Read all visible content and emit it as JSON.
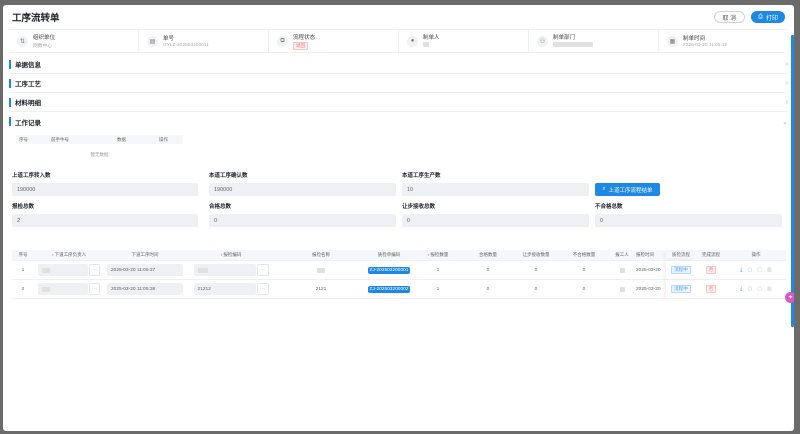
{
  "header": {
    "title": "工序流转单",
    "cancel_label": "取 消",
    "print_label": "打印"
  },
  "info": [
    {
      "label": "组织单位",
      "value": "网数中心",
      "icon": "org-icon"
    },
    {
      "label": "单号",
      "value": "GYLZ-202503200011",
      "icon": "document-icon"
    },
    {
      "label": "流程状态",
      "value": "退回",
      "icon": "flow-icon"
    },
    {
      "label": "制单人",
      "value": "",
      "icon": "user-icon"
    },
    {
      "label": "制单部门",
      "value": "",
      "icon": "department-icon"
    },
    {
      "label": "制单时间",
      "value": "2025-03-20 11:05:12",
      "icon": "calendar-icon"
    }
  ],
  "sections": [
    "单据信息",
    "工序工艺",
    "材料明细",
    "工作记录"
  ],
  "work_record": {
    "headers": [
      "序号",
      "前手牛号",
      "数据",
      "操作"
    ],
    "empty": "暂无数据"
  },
  "form": {
    "prev_in_label": "上道工序转入数",
    "prev_in_value": "190000",
    "confirm_label": "本道工序确认数",
    "confirm_value": "190000",
    "produce_label": "本道工序生产数",
    "produce_value": "10",
    "query_btn": "上道工序流程结单",
    "report_label": "报检总数",
    "report_value": "2",
    "pass_label": "合格总数",
    "pass_value": "0",
    "concede_label": "让步接收总数",
    "concede_value": "0",
    "fail_label": "不合格总数",
    "fail_value": "0"
  },
  "grid": {
    "headers": [
      "序号",
      "下道工序负责人",
      "下道工序时间",
      "报检编码",
      "报检名称",
      "质检单编码",
      "报检数量",
      "合格数量",
      "让步接收数量",
      "不合格数量",
      "报工人",
      "报检时间",
      "质检流程",
      "完成流程",
      "操作"
    ],
    "rows": [
      {
        "index": "1",
        "time": "2025-03-20 11:05:37",
        "code": "",
        "name": "",
        "qc_code": "ZJ-202503200001",
        "qty": "1",
        "pass": "0",
        "concede": "0",
        "fail": "0",
        "report_time": "2025-03-20",
        "qc_flow": "流程中",
        "done_flow": "否"
      },
      {
        "index": "2",
        "time": "2025-03-20 11:05:38",
        "code": "21212",
        "name": "2121",
        "qc_code": "ZJ-202503200002",
        "qty": "1",
        "pass": "0",
        "concede": "0",
        "fail": "0",
        "report_time": "2025-03-20",
        "qc_flow": "流程中",
        "done_flow": "否"
      }
    ]
  }
}
